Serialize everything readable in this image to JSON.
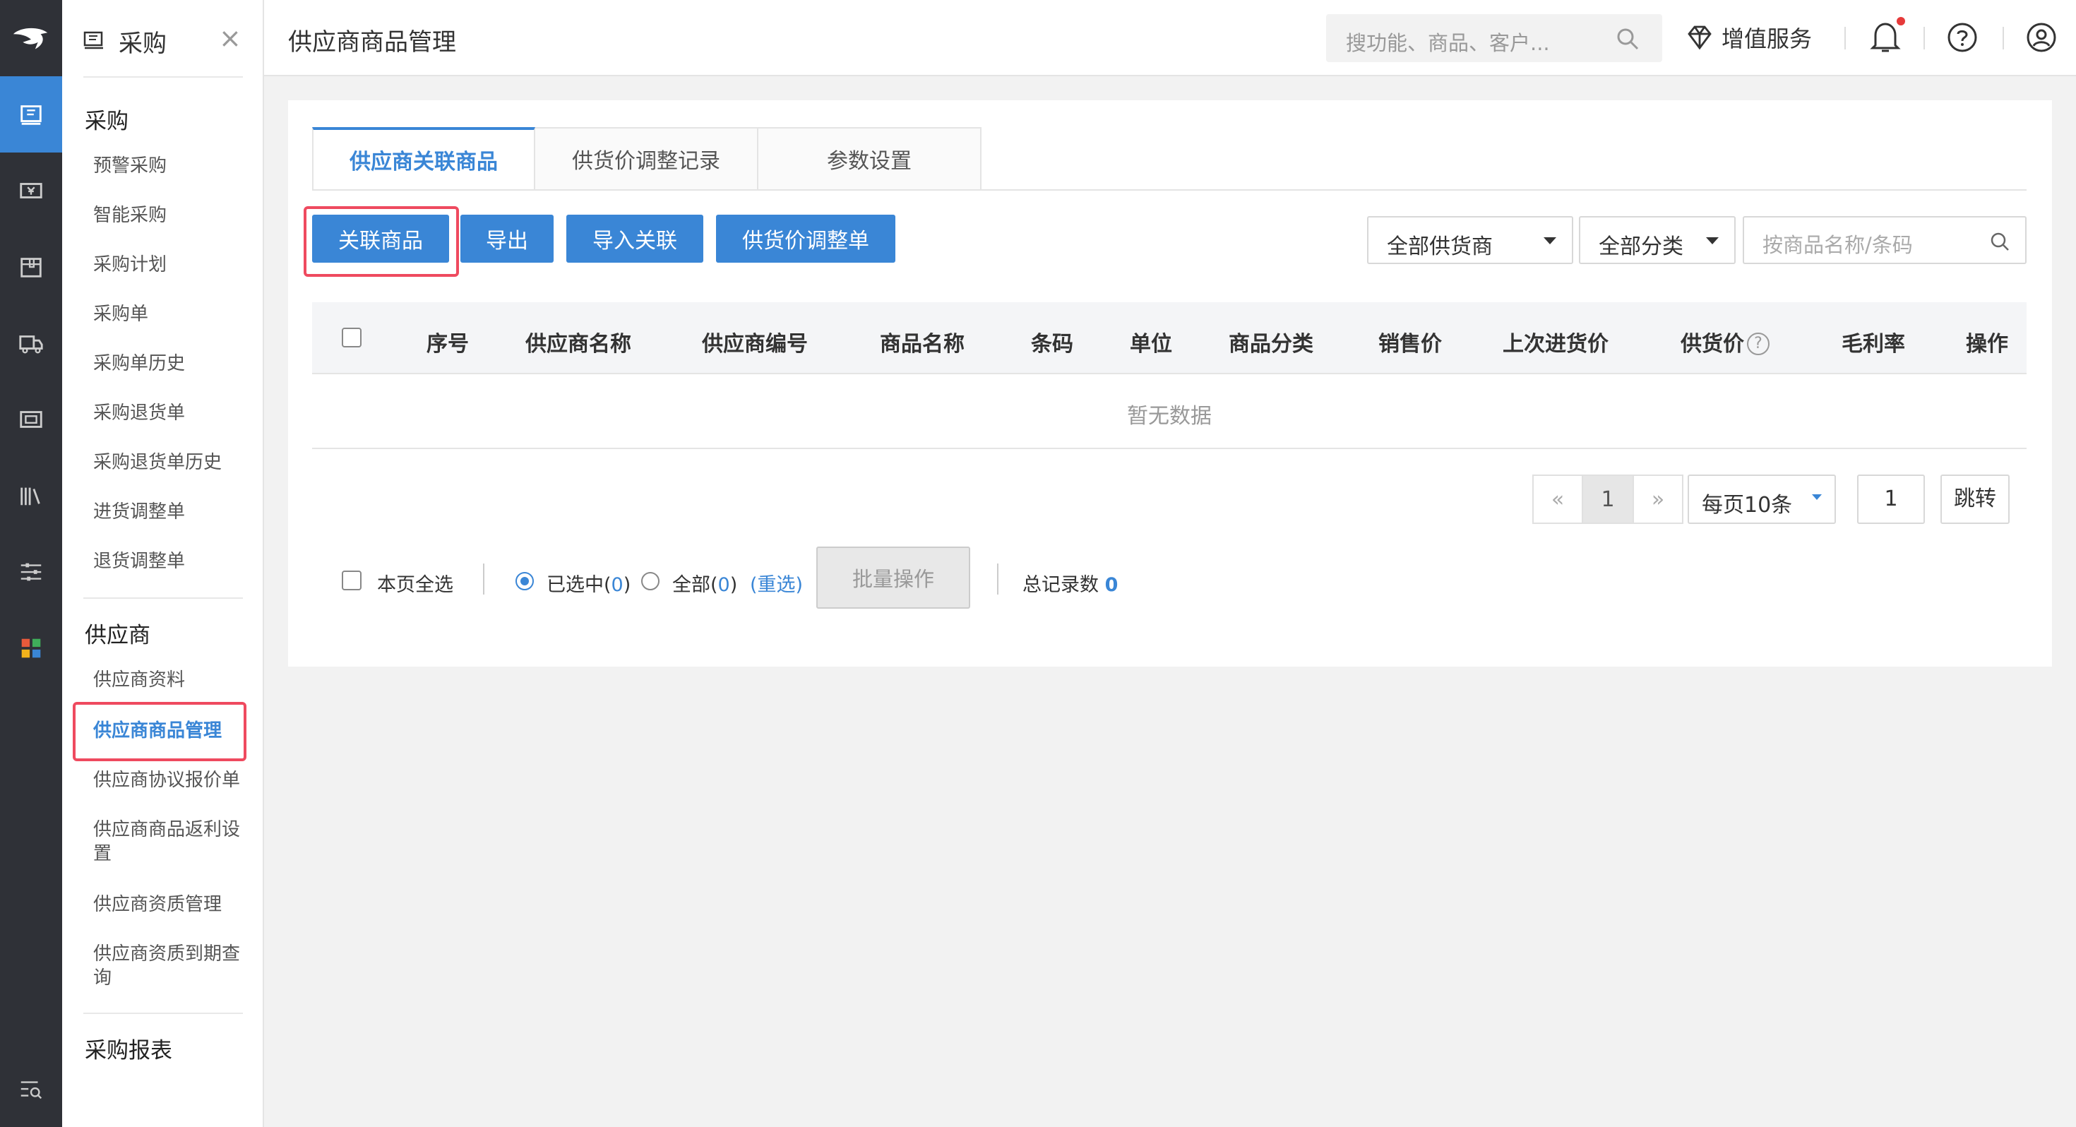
{
  "sidebar": {
    "title": "采购",
    "close_symbol": "×",
    "groups": [
      {
        "title": "采购",
        "items": [
          "预警采购",
          "智能采购",
          "采购计划",
          "采购单",
          "采购单历史",
          "采购退货单",
          "采购退货单历史",
          "进货调整单",
          "退货调整单"
        ]
      },
      {
        "title": "供应商",
        "items": [
          "供应商资料",
          "供应商商品管理",
          "供应商协议报价单",
          "供应商商品返利设置",
          "供应商资质管理",
          "供应商资质到期查询"
        ]
      },
      {
        "title": "采购报表",
        "items": []
      }
    ],
    "active_item": "供应商商品管理"
  },
  "rail_icons": [
    "logo-icon",
    "purchase-icon",
    "cash-icon",
    "box-icon",
    "truck-icon",
    "card-icon",
    "books-icon",
    "sliders-icon",
    "apps-icon",
    "search-list-icon"
  ],
  "header": {
    "title": "供应商商品管理",
    "search_placeholder": "搜功能、商品、客户...",
    "vas_label": "增值服务"
  },
  "tabs": [
    {
      "label": "供应商关联商品",
      "active": true
    },
    {
      "label": "供货价调整记录",
      "active": false
    },
    {
      "label": "参数设置",
      "active": false
    }
  ],
  "toolbar": {
    "buttons": [
      "关联商品",
      "导出",
      "导入关联",
      "供货价调整单"
    ],
    "supplier_select": "全部供货商",
    "category_select": "全部分类",
    "search_placeholder": "按商品名称/条码"
  },
  "table": {
    "columns": [
      "序号",
      "供应商名称",
      "供应商编号",
      "商品名称",
      "条码",
      "单位",
      "商品分类",
      "销售价",
      "上次进货价",
      "供货价",
      "毛利率",
      "操作"
    ],
    "help_symbol": "?",
    "empty_text": "暂无数据"
  },
  "pagination": {
    "prev": "«",
    "current": "1",
    "next": "»",
    "page_size": "每页10条",
    "jump_value": "1",
    "jump_label": "跳转"
  },
  "footer": {
    "select_page": "本页全选",
    "selected_prefix": "已选中(",
    "selected_count": "0",
    "selected_suffix": ")",
    "all_prefix": "全部(",
    "all_count": "0",
    "all_suffix": ")",
    "reselect": "(重选)",
    "batch": "批量操作",
    "total_label": "总记录数",
    "total_count": "0"
  },
  "colors": {
    "accent": "#3a86d6",
    "highlight": "#ef4a5f",
    "rail": "#2f3137"
  }
}
